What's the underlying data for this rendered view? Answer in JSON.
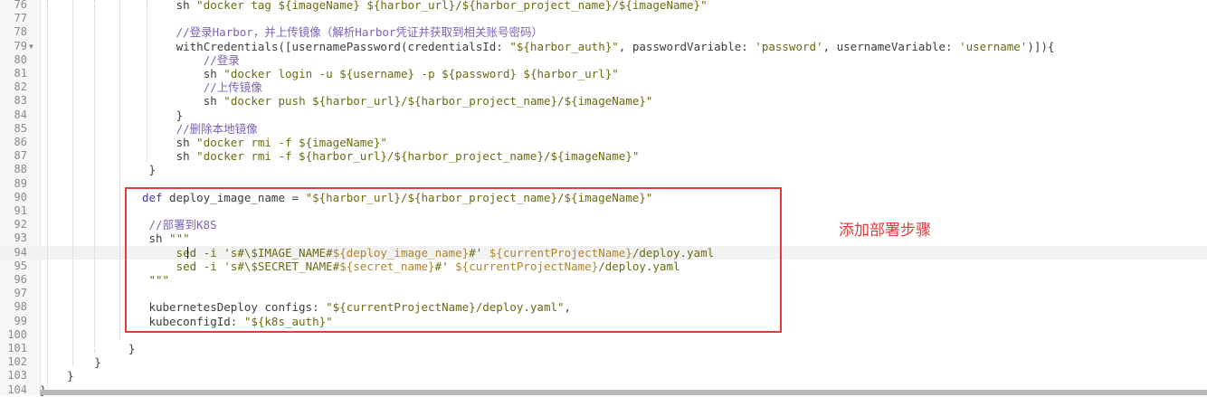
{
  "editor": {
    "active_line": 94,
    "lines": [
      {
        "n": "76",
        "indent": 20,
        "tokens": [
          {
            "c": "plain",
            "t": "sh "
          },
          {
            "c": "str",
            "t": "\"docker tag ${imageName} ${harbor_url}/${harbor_project_name}/${imageName}\""
          }
        ]
      },
      {
        "n": "77",
        "indent": 0,
        "tokens": []
      },
      {
        "n": "78",
        "indent": 20,
        "tokens": [
          {
            "c": "cmt",
            "t": "//登录Harbor，并上传镜像（解析Harbor凭证并获取到相关账号密码）"
          }
        ]
      },
      {
        "n": "79",
        "indent": 20,
        "fold": true,
        "tokens": [
          {
            "c": "plain",
            "t": "withCredentials([usernamePassword(credentialsId: "
          },
          {
            "c": "str",
            "t": "\"${harbor_auth}\""
          },
          {
            "c": "plain",
            "t": ", passwordVariable: "
          },
          {
            "c": "str",
            "t": "'password'"
          },
          {
            "c": "plain",
            "t": ", usernameVariable: "
          },
          {
            "c": "str",
            "t": "'username'"
          },
          {
            "c": "plain",
            "t": ")]){"
          }
        ]
      },
      {
        "n": "80",
        "indent": 24,
        "tokens": [
          {
            "c": "cmt",
            "t": "//登录"
          }
        ]
      },
      {
        "n": "81",
        "indent": 24,
        "tokens": [
          {
            "c": "plain",
            "t": "sh "
          },
          {
            "c": "str",
            "t": "\"docker login -u ${username} -p ${password} ${harbor_url}\""
          }
        ]
      },
      {
        "n": "82",
        "indent": 24,
        "tokens": [
          {
            "c": "cmt",
            "t": "//上传镜像"
          }
        ]
      },
      {
        "n": "83",
        "indent": 24,
        "tokens": [
          {
            "c": "plain",
            "t": "sh "
          },
          {
            "c": "str",
            "t": "\"docker push ${harbor_url}/${harbor_project_name}/${imageName}\""
          }
        ]
      },
      {
        "n": "84",
        "indent": 20,
        "tokens": [
          {
            "c": "plain",
            "t": "}"
          }
        ]
      },
      {
        "n": "85",
        "indent": 20,
        "tokens": [
          {
            "c": "cmt",
            "t": "//删除本地镜像"
          }
        ]
      },
      {
        "n": "86",
        "indent": 20,
        "tokens": [
          {
            "c": "plain",
            "t": "sh "
          },
          {
            "c": "str",
            "t": "\"docker rmi -f ${imageName}\""
          }
        ]
      },
      {
        "n": "87",
        "indent": 20,
        "tokens": [
          {
            "c": "plain",
            "t": "sh "
          },
          {
            "c": "str",
            "t": "\"docker rmi -f ${harbor_url}/${harbor_project_name}/${imageName}\""
          }
        ]
      },
      {
        "n": "88",
        "indent": 16,
        "tokens": [
          {
            "c": "plain",
            "t": "}"
          }
        ]
      },
      {
        "n": "89",
        "indent": 0,
        "tokens": []
      },
      {
        "n": "90",
        "indent": 15,
        "tokens": [
          {
            "c": "kw",
            "t": "def"
          },
          {
            "c": "plain",
            "t": " deploy_image_name = "
          },
          {
            "c": "str",
            "t": "\"${harbor_url}/${harbor_project_name}/${imageName}\""
          }
        ]
      },
      {
        "n": "91",
        "indent": 0,
        "tokens": []
      },
      {
        "n": "92",
        "indent": 16,
        "tokens": [
          {
            "c": "cmt",
            "t": "//部署到K8S"
          }
        ]
      },
      {
        "n": "93",
        "indent": 16,
        "tokens": [
          {
            "c": "plain",
            "t": "sh "
          },
          {
            "c": "str",
            "t": "\"\"\""
          }
        ]
      },
      {
        "n": "94",
        "indent": 20,
        "tokens": [
          {
            "c": "str",
            "t": "sed -i 's#\\$IMAGE_NAME#"
          },
          {
            "c": "var",
            "t": "${deploy_image_name}"
          },
          {
            "c": "str",
            "t": "#' "
          },
          {
            "c": "var",
            "t": "${currentProjectName}"
          },
          {
            "c": "str",
            "t": "/deploy.yaml"
          }
        ]
      },
      {
        "n": "95",
        "indent": 20,
        "tokens": [
          {
            "c": "str",
            "t": "sed -i 's#\\$SECRET_NAME#"
          },
          {
            "c": "var",
            "t": "${secret_name}"
          },
          {
            "c": "str",
            "t": "#' "
          },
          {
            "c": "var",
            "t": "${currentProjectName}"
          },
          {
            "c": "str",
            "t": "/deploy.yaml"
          }
        ]
      },
      {
        "n": "96",
        "indent": 16,
        "tokens": [
          {
            "c": "str",
            "t": "\"\"\""
          }
        ]
      },
      {
        "n": "97",
        "indent": 0,
        "tokens": []
      },
      {
        "n": "98",
        "indent": 16,
        "tokens": [
          {
            "c": "plain",
            "t": "kubernetesDeploy configs: "
          },
          {
            "c": "str",
            "t": "\"${currentProjectName}/deploy.yaml\""
          },
          {
            "c": "plain",
            "t": ","
          }
        ]
      },
      {
        "n": "99",
        "indent": 16,
        "tokens": [
          {
            "c": "plain",
            "t": "kubeconfigId: "
          },
          {
            "c": "str",
            "t": "\"${k8s_auth}\""
          }
        ]
      },
      {
        "n": "100",
        "indent": 0,
        "tokens": []
      },
      {
        "n": "101",
        "indent": 13,
        "tokens": [
          {
            "c": "plain",
            "t": "}"
          }
        ]
      },
      {
        "n": "102",
        "indent": 8,
        "tokens": [
          {
            "c": "plain",
            "t": "}"
          }
        ]
      },
      {
        "n": "103",
        "indent": 4,
        "tokens": [
          {
            "c": "plain",
            "t": "}"
          }
        ]
      },
      {
        "n": "104",
        "indent": 0,
        "tokens": [
          {
            "c": "plain",
            "t": "}"
          }
        ]
      }
    ]
  },
  "annotation": {
    "text": "添加部署步骤",
    "color": "#e33b3b"
  },
  "colors": {
    "string": "#6b6b12",
    "comment": "#7c63b4",
    "keyword": "#3b3b9a",
    "variable": "#b0852b"
  }
}
